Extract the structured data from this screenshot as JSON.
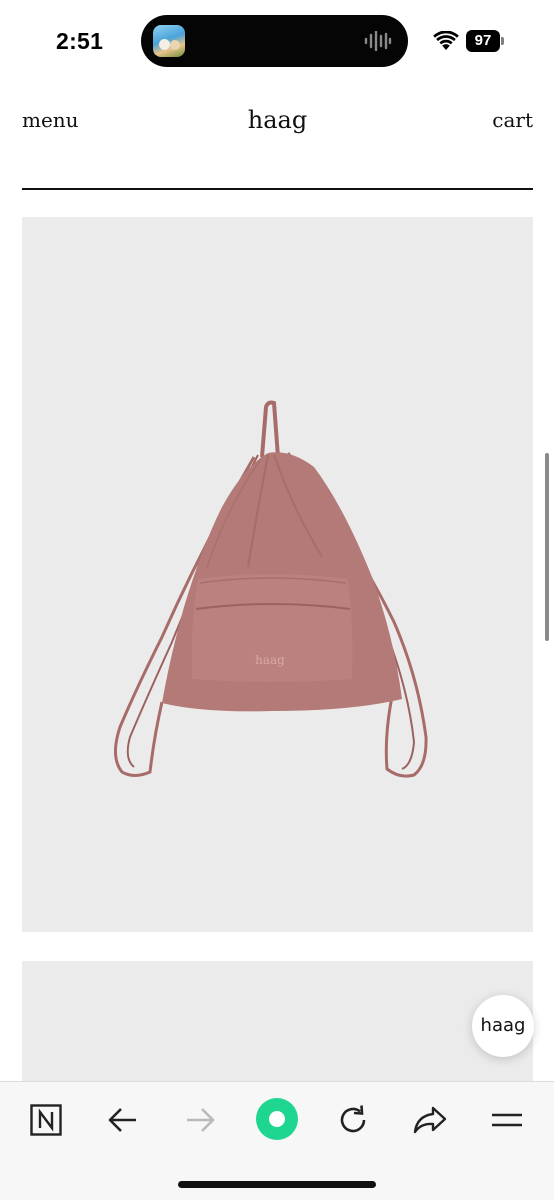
{
  "status_bar": {
    "time": "2:51",
    "battery": "97",
    "icons": [
      "app-thumbnail-icon",
      "audio-waveform-icon",
      "wifi-icon",
      "battery-icon"
    ]
  },
  "header": {
    "menu_label": "menu",
    "brand": "haag",
    "cart_label": "cart"
  },
  "product": {
    "bag_logo": "haag",
    "bag_color": "#b47a77",
    "background_color": "#ebebeb"
  },
  "floating_chip": {
    "label": "haag"
  },
  "toolbar": {
    "icons": [
      "n-logo-icon",
      "back-arrow-icon",
      "forward-arrow-icon",
      "record-icon",
      "reload-icon",
      "share-icon",
      "menu-lines-icon"
    ],
    "accent_color": "#1ed68f"
  }
}
